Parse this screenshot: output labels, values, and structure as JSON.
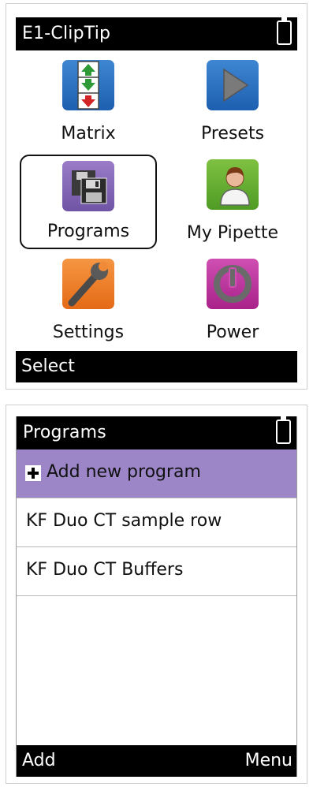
{
  "home": {
    "title": "E1-ClipTip",
    "tiles": [
      {
        "label": "Matrix",
        "icon": "matrix-arrows-icon",
        "color": "#2f73c3"
      },
      {
        "label": "Presets",
        "icon": "play-icon",
        "color": "#2f73c3"
      },
      {
        "label": "Programs",
        "icon": "floppy-disk-icon",
        "color": "#8667b8",
        "selected": true
      },
      {
        "label": "My Pipette",
        "icon": "user-icon",
        "color": "#68b032"
      },
      {
        "label": "Settings",
        "icon": "wrench-icon",
        "color": "#ee7e2b"
      },
      {
        "label": "Power",
        "icon": "power-icon",
        "color": "#bd379e"
      }
    ],
    "softkey_left": "Select"
  },
  "programs": {
    "title": "Programs",
    "add_label": "Add new program",
    "items": [
      "KF Duo CT sample row",
      "KF Duo CT Buffers"
    ],
    "softkey_left": "Add",
    "softkey_right": "Menu",
    "highlight_color": "#9c86c8"
  }
}
